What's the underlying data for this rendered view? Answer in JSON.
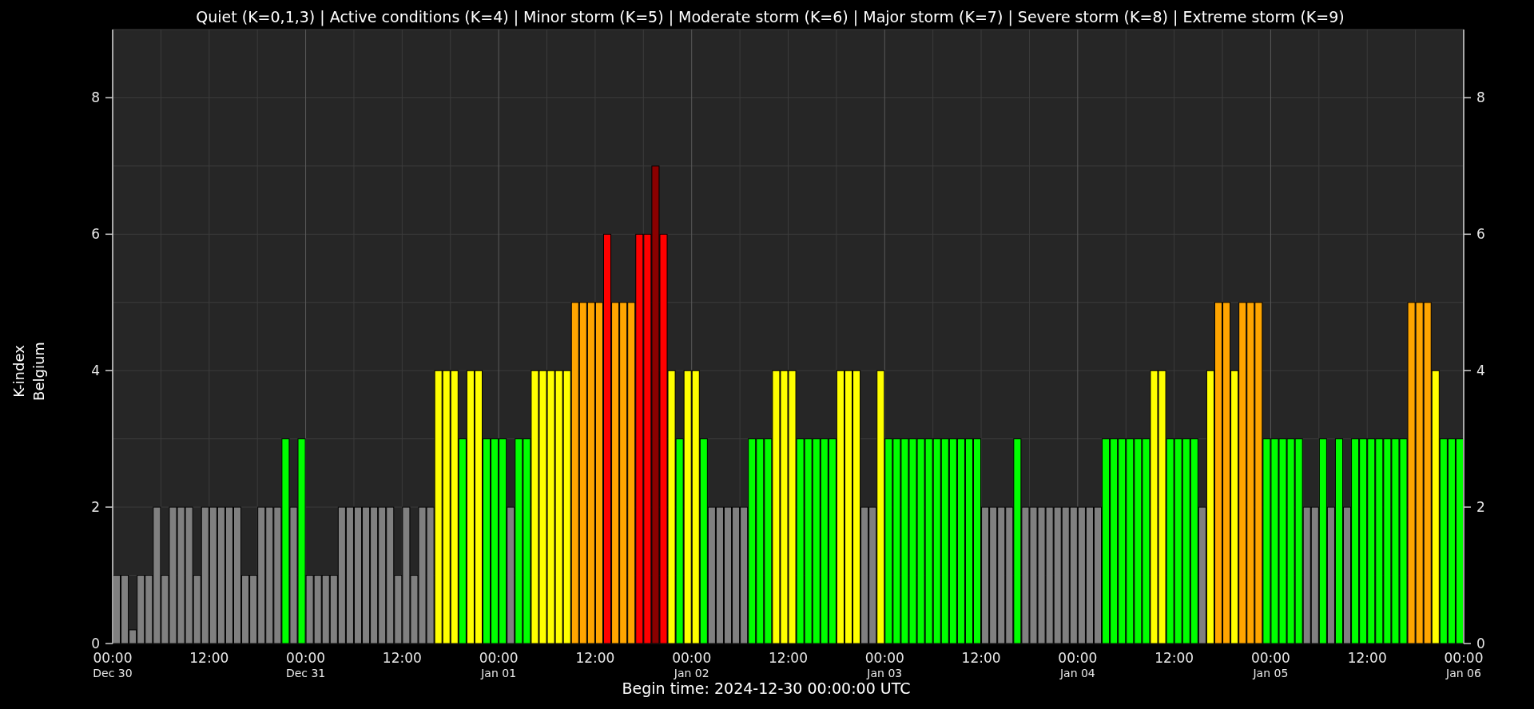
{
  "chart_data": {
    "type": "bar",
    "title": "Quiet (K=0,1,3) | Active conditions (K=4) | Minor storm (K=5) | Moderate storm (K=6) | Major storm (K=7) | Severe storm (K=8) | Extreme storm (K=9)",
    "xlabel": "Begin time: 2024-12-30 00:00:00 UTC",
    "ylabel": "Belgium",
    "grid": true,
    "categories": [
      "00:00\nDec 30",
      null,
      null,
      null,
      null,
      null,
      null,
      null,
      null,
      null,
      null,
      null,
      "12:00",
      null,
      null,
      null,
      null,
      null,
      null,
      null,
      null,
      null,
      null,
      null,
      "00:00\nDec 31",
      null,
      null,
      null,
      null,
      null,
      null,
      null,
      null,
      null,
      null,
      null,
      "12:00",
      null,
      null,
      null,
      null,
      null,
      null,
      null,
      null,
      null,
      null,
      null,
      "00:00\nJan 01",
      null,
      null,
      null,
      null,
      null,
      null,
      null,
      null,
      null,
      null,
      null,
      "12:00",
      null,
      null,
      null,
      null,
      null,
      null,
      null,
      null,
      null,
      null,
      null,
      "00:00\nJan 02",
      null,
      null,
      null,
      null,
      null,
      null,
      null,
      null,
      null,
      null,
      null,
      "12:00",
      null,
      null,
      null,
      null,
      null,
      null,
      null,
      null,
      null,
      null,
      null,
      "00:00\nJan 03",
      null,
      null,
      null,
      null,
      null,
      null,
      null,
      null,
      null,
      null,
      null,
      "12:00",
      null,
      null,
      null,
      null,
      null,
      null,
      null,
      null,
      null,
      null,
      null,
      "00:00\nJan 04",
      null,
      null,
      null,
      null,
      null,
      null,
      null,
      null,
      null,
      null,
      null,
      "12:00",
      null,
      null,
      null,
      null,
      null,
      null,
      null,
      null,
      null,
      null,
      null,
      "00:00\nJan 05",
      null,
      null,
      null,
      null,
      null,
      null,
      null,
      null,
      null,
      null,
      null,
      "12:00",
      null,
      null,
      null,
      null,
      null,
      null,
      null,
      null,
      null,
      null,
      null
    ],
    "ylim": [
      0,
      9
    ],
    "yticks": [
      0,
      2,
      4,
      6,
      8
    ],
    "series": [
      {
        "name": "K-index",
        "values": [
          1,
          1,
          0.2,
          1,
          1,
          2,
          1,
          2,
          2,
          2,
          1,
          2,
          2,
          2,
          2,
          2,
          1,
          1,
          2,
          2,
          2,
          3,
          2,
          3,
          1,
          1,
          1,
          1,
          2,
          2,
          2,
          2,
          2,
          2,
          2,
          1,
          2,
          1,
          2,
          2,
          4,
          4,
          4,
          3,
          4,
          4,
          3,
          3,
          3,
          2,
          3,
          3,
          4,
          4,
          4,
          4,
          4,
          5,
          5,
          5,
          5,
          6,
          5,
          5,
          5,
          6,
          6,
          7,
          6,
          4,
          3,
          4,
          4,
          3,
          2,
          2,
          2,
          2,
          2,
          3,
          3,
          3,
          4,
          4,
          4,
          3,
          3,
          3,
          3,
          3,
          4,
          4,
          4,
          2,
          2,
          4,
          3,
          3,
          3,
          3,
          3,
          3,
          3,
          3,
          3,
          3,
          3,
          3,
          2,
          2,
          2,
          2,
          3,
          2,
          2,
          2,
          2,
          2,
          2,
          2,
          2,
          2,
          2,
          3,
          3,
          3,
          3,
          3,
          3,
          4,
          4,
          3,
          3,
          3,
          3,
          2,
          4,
          5,
          5,
          4,
          5,
          5,
          5,
          3,
          3,
          3,
          3,
          3,
          2,
          2,
          3,
          2,
          3,
          2,
          3,
          3,
          3,
          3,
          3,
          3,
          3,
          5,
          5,
          5,
          4,
          3,
          3,
          3
        ]
      }
    ]
  },
  "x_end_label": "00:00\nJan 06",
  "right_axis": {
    "ticks": [
      "8",
      "6",
      "4",
      "2",
      "0"
    ]
  },
  "k_levels": [
    {
      "color": "#808080"
    },
    {
      "color": "#808080"
    },
    {
      "color": "#808080"
    },
    {
      "color": "#00ff00"
    },
    {
      "color": "#ffff00"
    },
    {
      "color": "#ffa500"
    },
    {
      "color": "#ff0000"
    },
    {
      "color": "#8b0000"
    }
  ]
}
